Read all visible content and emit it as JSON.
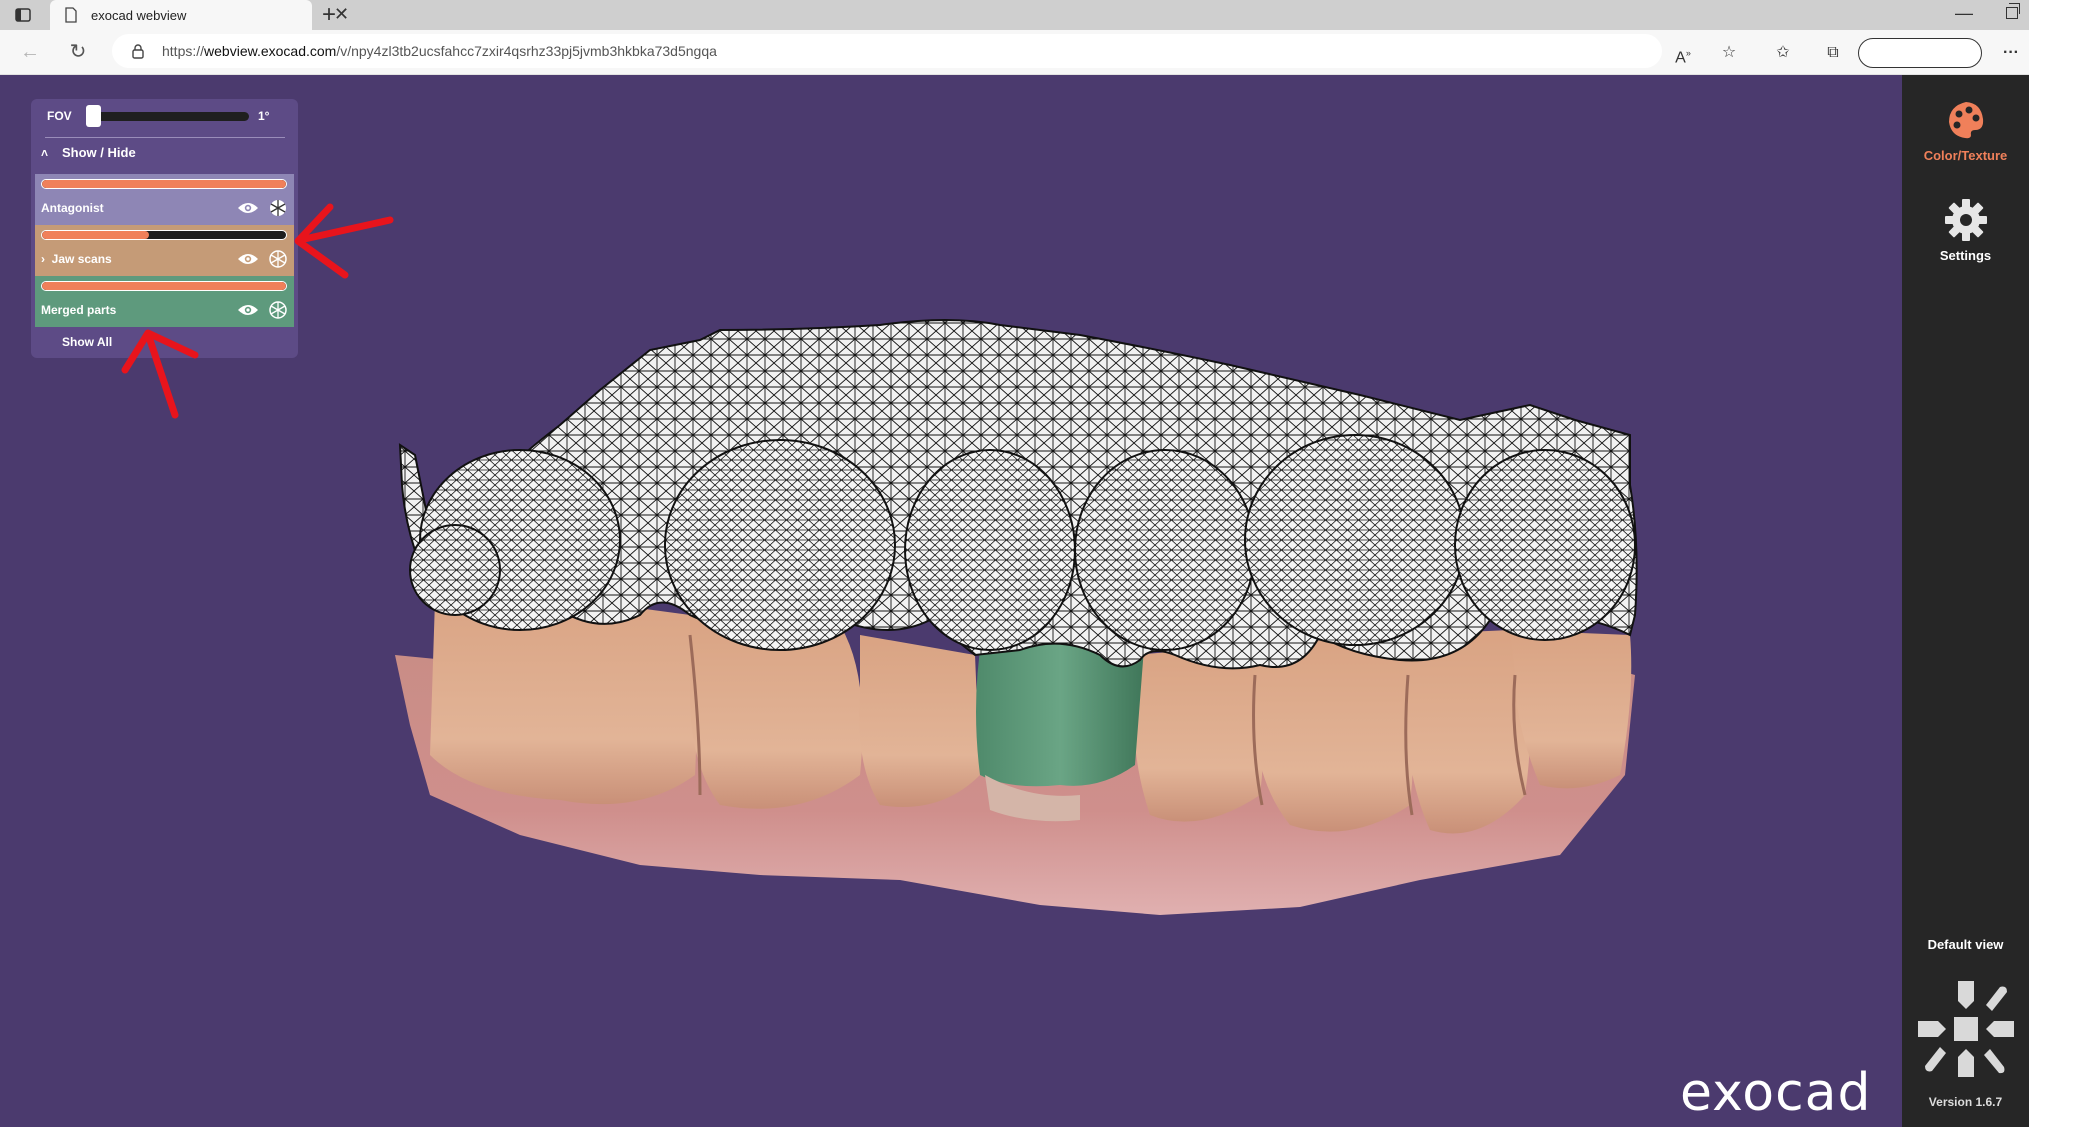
{
  "browser": {
    "tab_title": "exocad webview",
    "url_scheme": "https://",
    "url_host": "webview.exocad.com",
    "url_path": "/v/npy4zl3tb2ucsfahcc7zxir4qsrhz33pj5jvmb3hkbka73d5ngqa"
  },
  "viewer": {
    "fov_label": "FOV",
    "fov_value": "1°",
    "show_hide_label": "Show / Hide",
    "layers": [
      {
        "name": "Antagonist",
        "opacity": 1.0,
        "color": "#8e86b5"
      },
      {
        "name": "Jaw scans",
        "opacity": 0.44,
        "color": "#c59b77",
        "expandable": true
      },
      {
        "name": "Merged parts",
        "opacity": 1.0,
        "color": "#5e9a7d"
      }
    ],
    "show_all_label": "Show All",
    "logo_text": "exocad"
  },
  "rightbar": {
    "color_texture_label": "Color/Texture",
    "settings_label": "Settings",
    "default_view_label": "Default view",
    "version": "Version 1.6.7"
  },
  "colors": {
    "background": "#4b3a6e",
    "accent": "#f0805a",
    "annotation": "#e8141c"
  }
}
